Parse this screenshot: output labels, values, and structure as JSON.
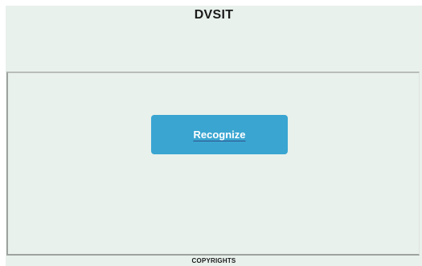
{
  "header": {
    "title": "DVSIT"
  },
  "main": {
    "recognize_button_label": "Recognize"
  },
  "footer": {
    "text": "COPYRIGHTS"
  },
  "colors": {
    "background": "#e8f1ec",
    "button": "#3aa5d1",
    "button_text": "#ffffff"
  }
}
